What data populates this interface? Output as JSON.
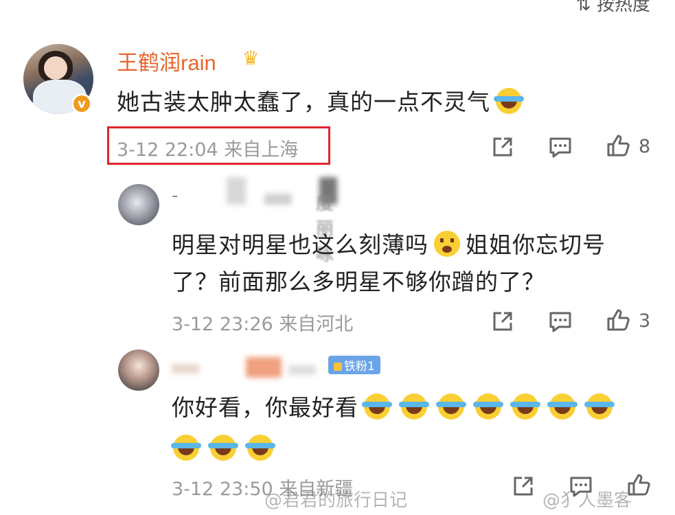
{
  "header": {
    "sort_label": "按热度"
  },
  "comment": {
    "username": "王鹤润rain",
    "text": "她古装太肿太蠢了，真的一点不灵气",
    "meta": "3-12 22:04 来自上海",
    "likes": "8"
  },
  "replies": [
    {
      "name_fragment": "度丽咏",
      "text_line1": "明星对明星也这么刻薄吗",
      "text_line1b": "姐姐你忘切号",
      "text_line2": "了？前面那么多明星不够你蹭的了？",
      "meta": "3-12 23:26 来自河北",
      "likes": "3"
    },
    {
      "badge": "铁粉1",
      "text": "你好看，你最好看",
      "meta": "3-12 23:50 来自新疆"
    }
  ],
  "watermarks": {
    "left": "@君君的旅行日记",
    "right": "@犭人墨客"
  },
  "colors": {
    "username": "#e8652d",
    "highlight": "#e0242b",
    "verified": "#f09a1a",
    "fan_badge": "#6aa4e8"
  }
}
